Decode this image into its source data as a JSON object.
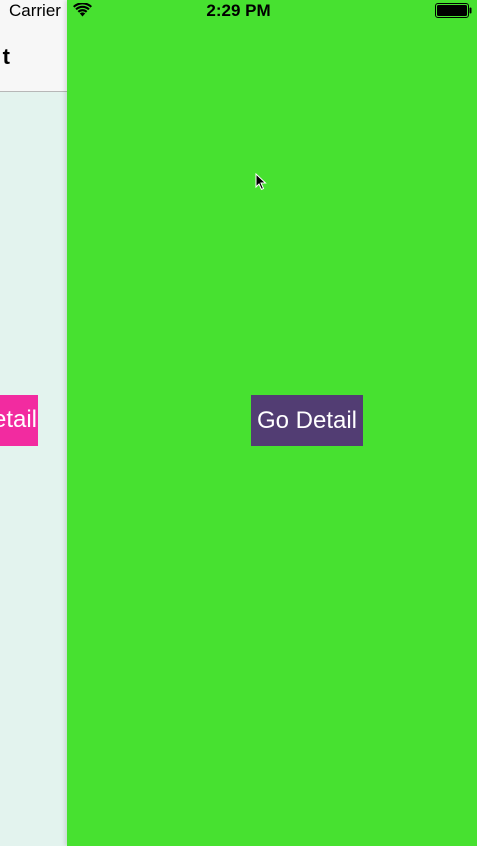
{
  "status_bar": {
    "carrier": "Carrier",
    "time": "2:29 PM",
    "wifi_icon": "wifi-icon",
    "battery_icon": "battery-icon"
  },
  "under_view": {
    "nav_title_visible": "t",
    "button_label_visible": "etail",
    "background_color": "#e3f3ee",
    "button_color": "#f22ba0"
  },
  "front_view": {
    "background_color": "#47e130",
    "button_label": "Go Detail",
    "button_color": "#523d73",
    "cursor_icon": "mouse-pointer-icon"
  }
}
